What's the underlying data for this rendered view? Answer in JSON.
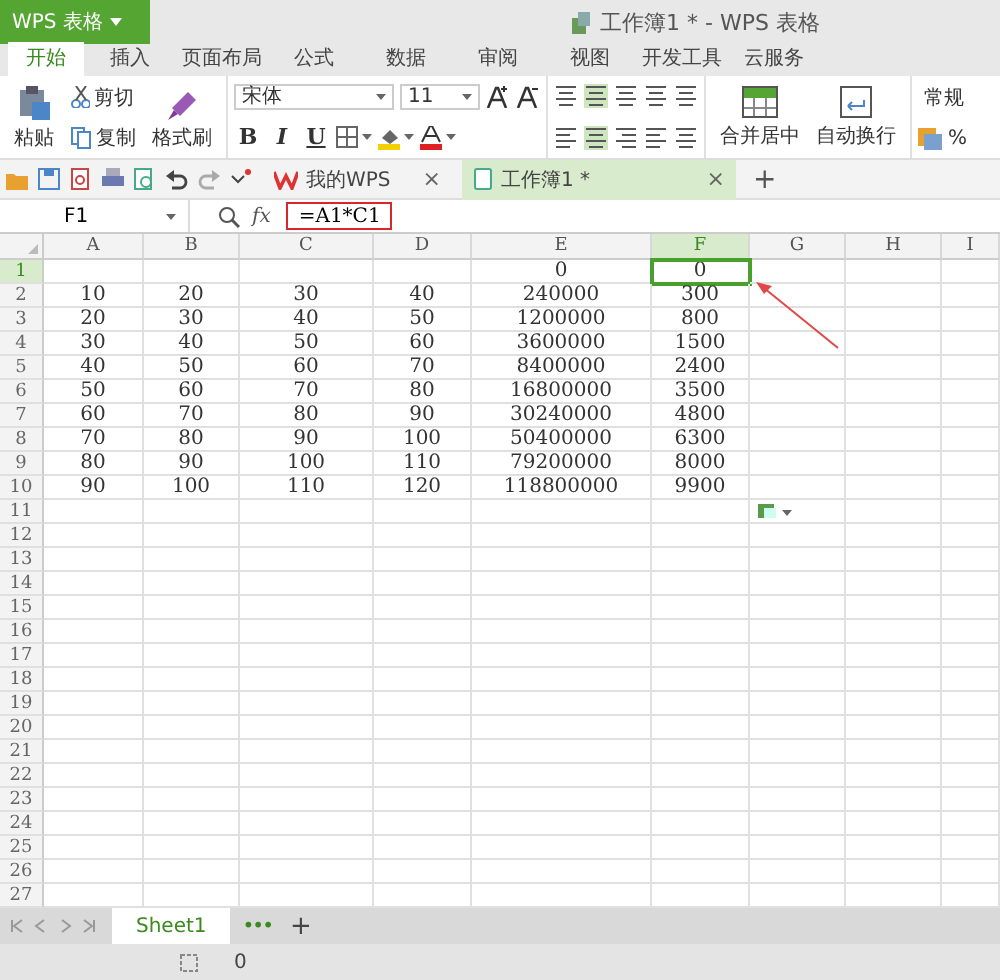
{
  "app_button": {
    "label": "WPS 表格"
  },
  "window": {
    "title": "工作簿1 * - WPS 表格"
  },
  "ribbon_tabs": [
    {
      "label": "开始",
      "selected": true
    },
    {
      "label": "插入",
      "selected": false
    },
    {
      "label": "页面布局",
      "selected": false
    },
    {
      "label": "公式",
      "selected": false
    },
    {
      "label": "数据",
      "selected": false
    },
    {
      "label": "审阅",
      "selected": false
    },
    {
      "label": "视图",
      "selected": false
    },
    {
      "label": "开发工具",
      "selected": false
    },
    {
      "label": "云服务",
      "selected": false
    }
  ],
  "ribbon": {
    "paste": "粘贴",
    "cut": "剪切",
    "copy": "复制",
    "format_painter": "格式刷",
    "font": "宋体",
    "font_size": "11",
    "bold": "B",
    "italic": "I",
    "underline": "U",
    "merge": "合并居中",
    "wrap": "自动换行",
    "number_format": "常规",
    "percent": "%"
  },
  "doc_tabs": [
    {
      "label": "我的WPS",
      "selected": false,
      "close": "×"
    },
    {
      "label": "工作簿1 *",
      "selected": true,
      "close": "×"
    }
  ],
  "new_tab": "+",
  "formula_bar": {
    "name_box": "F1",
    "fx": "fx",
    "formula": "=A1*C1"
  },
  "sheet": {
    "columns": [
      {
        "label": "A",
        "selected": false
      },
      {
        "label": "B",
        "selected": false
      },
      {
        "label": "C",
        "selected": false
      },
      {
        "label": "D",
        "selected": false
      },
      {
        "label": "E",
        "selected": false
      },
      {
        "label": "F",
        "selected": true
      },
      {
        "label": "G",
        "selected": false
      },
      {
        "label": "H",
        "selected": false
      },
      {
        "label": "I",
        "selected": false
      }
    ],
    "rows": [
      {
        "header": "1",
        "selected": true,
        "cells": {
          "E": "0",
          "F": "0"
        }
      },
      {
        "header": "2",
        "selected": false,
        "cells": {
          "A": "10",
          "B": "20",
          "C": "30",
          "D": "40",
          "E": "240000",
          "F": "300"
        }
      },
      {
        "header": "3",
        "selected": false,
        "cells": {
          "A": "20",
          "B": "30",
          "C": "40",
          "D": "50",
          "E": "1200000",
          "F": "800"
        }
      },
      {
        "header": "4",
        "selected": false,
        "cells": {
          "A": "30",
          "B": "40",
          "C": "50",
          "D": "60",
          "E": "3600000",
          "F": "1500"
        }
      },
      {
        "header": "5",
        "selected": false,
        "cells": {
          "A": "40",
          "B": "50",
          "C": "60",
          "D": "70",
          "E": "8400000",
          "F": "2400"
        }
      },
      {
        "header": "6",
        "selected": false,
        "cells": {
          "A": "50",
          "B": "60",
          "C": "70",
          "D": "80",
          "E": "16800000",
          "F": "3500"
        }
      },
      {
        "header": "7",
        "selected": false,
        "cells": {
          "A": "60",
          "B": "70",
          "C": "80",
          "D": "90",
          "E": "30240000",
          "F": "4800"
        }
      },
      {
        "header": "8",
        "selected": false,
        "cells": {
          "A": "70",
          "B": "80",
          "C": "90",
          "D": "100",
          "E": "50400000",
          "F": "6300"
        }
      },
      {
        "header": "9",
        "selected": false,
        "cells": {
          "A": "80",
          "B": "90",
          "C": "100",
          "D": "110",
          "E": "79200000",
          "F": "8000"
        }
      },
      {
        "header": "10",
        "selected": false,
        "cells": {
          "A": "90",
          "B": "100",
          "C": "110",
          "D": "120",
          "E": "118800000",
          "F": "9900"
        }
      },
      {
        "header": "11",
        "selected": false
      },
      {
        "header": "12",
        "selected": false
      },
      {
        "header": "13",
        "selected": false
      },
      {
        "header": "14",
        "selected": false
      },
      {
        "header": "15",
        "selected": false
      },
      {
        "header": "16",
        "selected": false
      },
      {
        "header": "17",
        "selected": false
      },
      {
        "header": "18",
        "selected": false
      },
      {
        "header": "19",
        "selected": false
      },
      {
        "header": "20",
        "selected": false
      },
      {
        "header": "21",
        "selected": false
      },
      {
        "header": "22",
        "selected": false
      },
      {
        "header": "23",
        "selected": false
      },
      {
        "header": "24",
        "selected": false
      },
      {
        "header": "25",
        "selected": false
      },
      {
        "header": "26",
        "selected": false
      },
      {
        "header": "27",
        "selected": false
      }
    ]
  },
  "sheet_tabs": [
    {
      "label": "Sheet1",
      "selected": true
    }
  ],
  "more_sheets": "•••",
  "add_sheet": "+",
  "status_bar": {
    "value": "0"
  }
}
